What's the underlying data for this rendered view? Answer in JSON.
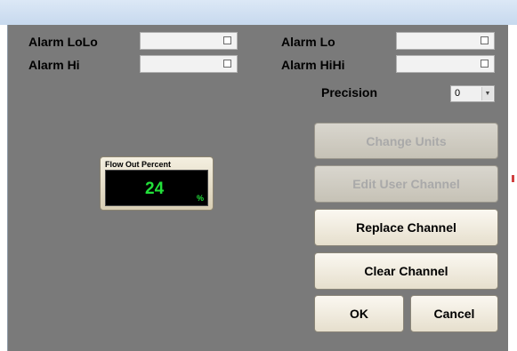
{
  "alarms": {
    "lolo_label": "Alarm LoLo",
    "lo_label": "Alarm Lo",
    "hi_label": "Alarm Hi",
    "hihi_label": "Alarm HiHi"
  },
  "precision": {
    "label": "Precision",
    "value": "0"
  },
  "meter": {
    "title": "Flow Out Percent",
    "value": "24",
    "unit": "%",
    "value_color": "#22e03a"
  },
  "buttons": {
    "change_units": "Change Units",
    "edit_user_channel": "Edit User Channel",
    "replace_channel": "Replace Channel",
    "clear_channel": "Clear Channel",
    "ok": "OK",
    "cancel": "Cancel"
  },
  "icons": {
    "checkbox": "checkbox-icon",
    "dropdown": "chevron-down-icon"
  }
}
